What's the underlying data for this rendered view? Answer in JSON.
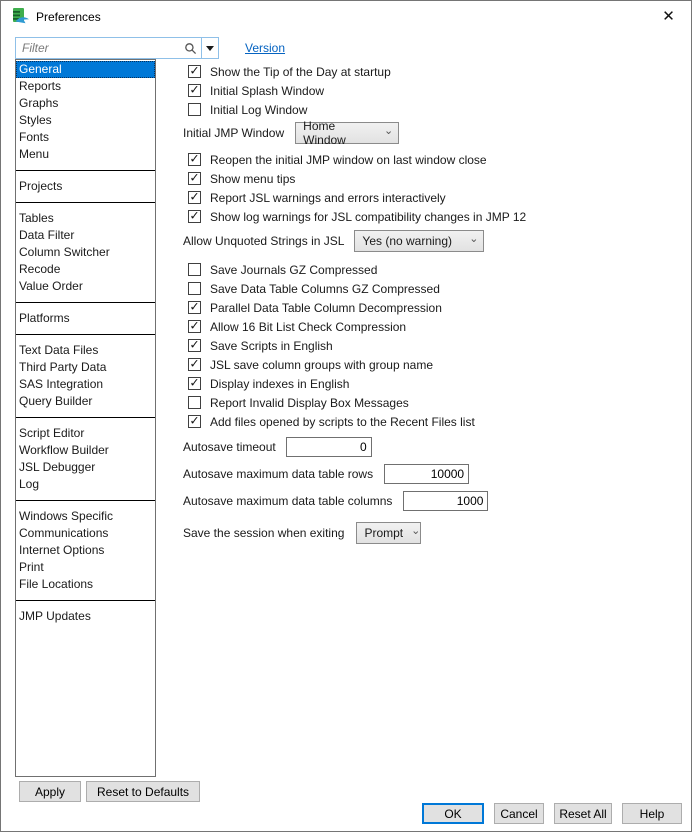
{
  "window": {
    "title": "Preferences"
  },
  "icons": {
    "chevron_down": "⌄",
    "close": "✕"
  },
  "colors": {
    "accent": "#0078d7",
    "link": "#0563c1",
    "selection_text": "#ffffff",
    "button_face": "#e1e1e1",
    "icon_green": "#3fae4d",
    "icon_blue": "#2f9ad2"
  },
  "toolbar": {
    "filter_placeholder": "Filter",
    "version_label": "Version"
  },
  "sidebar": {
    "items": [
      {
        "label": "General",
        "classes": "selected"
      },
      {
        "label": "Reports"
      },
      {
        "label": "Graphs"
      },
      {
        "label": "Styles"
      },
      {
        "label": "Fonts"
      },
      {
        "label": "Menu"
      },
      {
        "classes": "separator"
      },
      {
        "label": "Projects"
      },
      {
        "classes": "separator"
      },
      {
        "label": "Tables"
      },
      {
        "label": "Data Filter"
      },
      {
        "label": "Column Switcher"
      },
      {
        "label": "Recode"
      },
      {
        "label": "Value Order"
      },
      {
        "classes": "separator"
      },
      {
        "label": "Platforms"
      },
      {
        "classes": "separator"
      },
      {
        "label": "Text Data Files"
      },
      {
        "label": "Third Party Data"
      },
      {
        "label": "SAS Integration"
      },
      {
        "label": "Query Builder"
      },
      {
        "classes": "separator"
      },
      {
        "label": "Script Editor"
      },
      {
        "label": "Workflow Builder"
      },
      {
        "label": "JSL Debugger"
      },
      {
        "label": "Log"
      },
      {
        "classes": "separator"
      },
      {
        "label": "Windows Specific"
      },
      {
        "label": "Communications"
      },
      {
        "label": "Internet Options"
      },
      {
        "label": "Print"
      },
      {
        "label": "File Locations"
      },
      {
        "classes": "separator"
      },
      {
        "label": "JMP Updates"
      }
    ],
    "apply_label": "Apply",
    "reset_defaults_label": "Reset to Defaults"
  },
  "main": {
    "group1": [
      {
        "label": "Show the Tip of the Day at startup",
        "check": "✓"
      },
      {
        "label": "Initial Splash Window",
        "check": "✓"
      },
      {
        "label": "Initial Log Window",
        "check": ""
      }
    ],
    "initial_jmp": {
      "label": "Initial JMP Window",
      "value": "Home Window"
    },
    "group2": [
      {
        "label": "Reopen the initial JMP window on last window close",
        "check": "✓"
      },
      {
        "label": "Show menu tips",
        "check": "✓"
      },
      {
        "label": "Report JSL warnings and errors interactively",
        "check": "✓"
      },
      {
        "label": "Show log warnings for JSL compatibility changes in JMP 12",
        "check": "✓"
      }
    ],
    "allow_unquoted": {
      "label": "Allow Unquoted Strings in JSL",
      "value": "Yes (no warning)"
    },
    "group3": [
      {
        "label": "Save Journals GZ Compressed",
        "check": ""
      },
      {
        "label": "Save Data Table Columns GZ Compressed",
        "check": ""
      },
      {
        "label": "Parallel Data Table Column Decompression",
        "check": "✓"
      },
      {
        "label": "Allow 16 Bit List Check Compression",
        "check": "✓"
      },
      {
        "label": "Save Scripts in English",
        "check": "✓"
      },
      {
        "label": "JSL save column groups with group name",
        "check": "✓"
      },
      {
        "label": "Display indexes in English",
        "check": "✓"
      },
      {
        "label": "Report Invalid Display Box Messages",
        "check": ""
      },
      {
        "label": "Add files opened by scripts to the Recent Files list",
        "check": "✓"
      }
    ],
    "autosave_timeout": {
      "label": "Autosave timeout",
      "value": "0"
    },
    "autosave_rows": {
      "label": "Autosave maximum data table rows",
      "value": "10000"
    },
    "autosave_columns": {
      "label": "Autosave maximum data table columns",
      "value": "1000"
    },
    "save_session": {
      "label": "Save the session when exiting",
      "value": "Prompt"
    }
  },
  "footer": {
    "ok_label": "OK",
    "cancel_label": "Cancel",
    "reset_all_label": "Reset All",
    "help_label": "Help"
  }
}
